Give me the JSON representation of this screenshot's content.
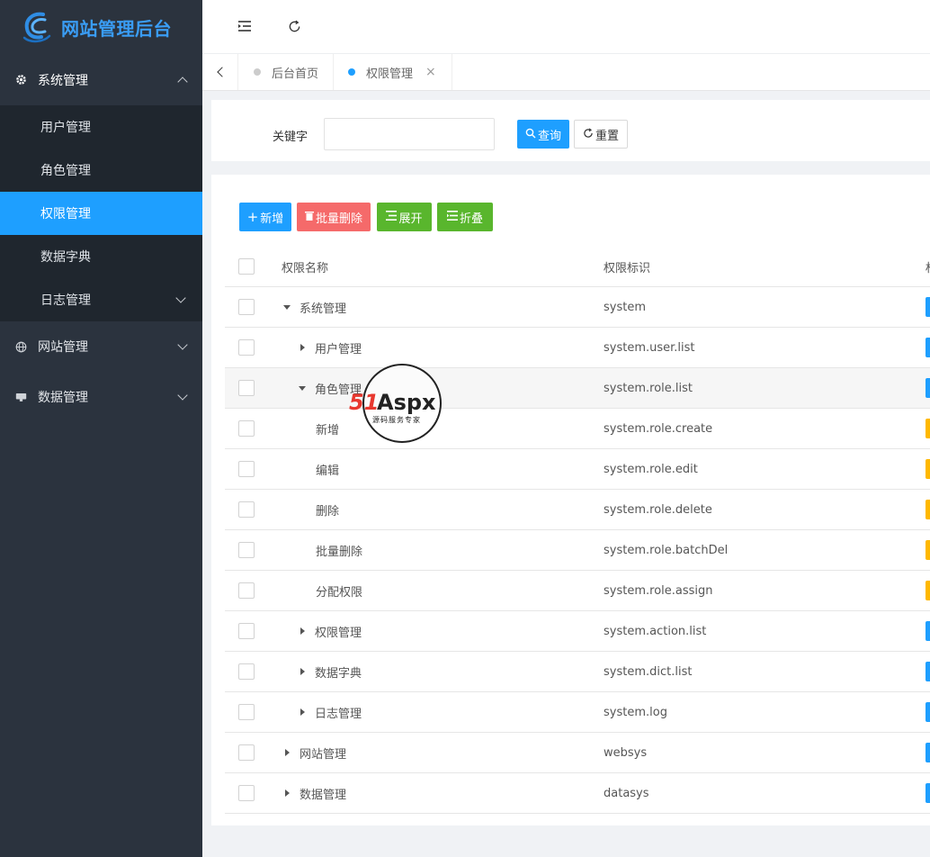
{
  "brand": {
    "title": "网站管理后台"
  },
  "sidebar": {
    "groups": [
      {
        "label": "系统管理",
        "icon": "gear-icon",
        "expanded": true,
        "items": [
          {
            "label": "用户管理"
          },
          {
            "label": "角色管理"
          },
          {
            "label": "权限管理",
            "active": true
          },
          {
            "label": "数据字典"
          },
          {
            "label": "日志管理",
            "has_children": true
          }
        ]
      },
      {
        "label": "网站管理",
        "icon": "globe-icon",
        "expanded": false
      },
      {
        "label": "数据管理",
        "icon": "database-icon",
        "expanded": false
      }
    ]
  },
  "tabs": [
    {
      "label": "后台首页",
      "active": false
    },
    {
      "label": "权限管理",
      "active": true,
      "close": "×"
    }
  ],
  "search": {
    "label": "关键字",
    "value": "",
    "placeholder": "",
    "query_label": "查询",
    "reset_label": "重置"
  },
  "toolbar": {
    "add_label": "新增",
    "batch_delete_label": "批量删除",
    "expand_label": "展开",
    "collapse_label": "折叠"
  },
  "table": {
    "columns": {
      "name": "权限名称",
      "code": "权限标识",
      "type": "权"
    },
    "rows": [
      {
        "name": "系统管理",
        "code": "system",
        "level": 0,
        "toggle": "down",
        "tag": "blue"
      },
      {
        "name": "用户管理",
        "code": "system.user.list",
        "level": 1,
        "toggle": "right",
        "tag": "blue"
      },
      {
        "name": "角色管理",
        "code": "system.role.list",
        "level": 1,
        "toggle": "down",
        "tag": "blue"
      },
      {
        "name": "新增",
        "code": "system.role.create",
        "level": 2,
        "toggle": "none",
        "tag": "orange"
      },
      {
        "name": "编辑",
        "code": "system.role.edit",
        "level": 2,
        "toggle": "none",
        "tag": "orange"
      },
      {
        "name": "删除",
        "code": "system.role.delete",
        "level": 2,
        "toggle": "none",
        "tag": "orange"
      },
      {
        "name": "批量删除",
        "code": "system.role.batchDel",
        "level": 2,
        "toggle": "none",
        "tag": "orange"
      },
      {
        "name": "分配权限",
        "code": "system.role.assign",
        "level": 2,
        "toggle": "none",
        "tag": "orange"
      },
      {
        "name": "权限管理",
        "code": "system.action.list",
        "level": 1,
        "toggle": "right",
        "tag": "blue"
      },
      {
        "name": "数据字典",
        "code": "system.dict.list",
        "level": 1,
        "toggle": "right",
        "tag": "blue"
      },
      {
        "name": "日志管理",
        "code": "system.log",
        "level": 1,
        "toggle": "right",
        "tag": "blue"
      },
      {
        "name": "网站管理",
        "code": "websys",
        "level": 0,
        "toggle": "right",
        "tag": "blue"
      },
      {
        "name": "数据管理",
        "code": "datasys",
        "level": 0,
        "toggle": "right",
        "tag": "blue"
      }
    ]
  },
  "watermark": {
    "brand": "51Aspx",
    "tagline": "源码服务专家"
  },
  "colors": {
    "primary": "#1e9fff",
    "danger": "#f56a6a",
    "success": "#59b62d",
    "warning": "#ffb800",
    "sidebar": "#2b333e"
  }
}
